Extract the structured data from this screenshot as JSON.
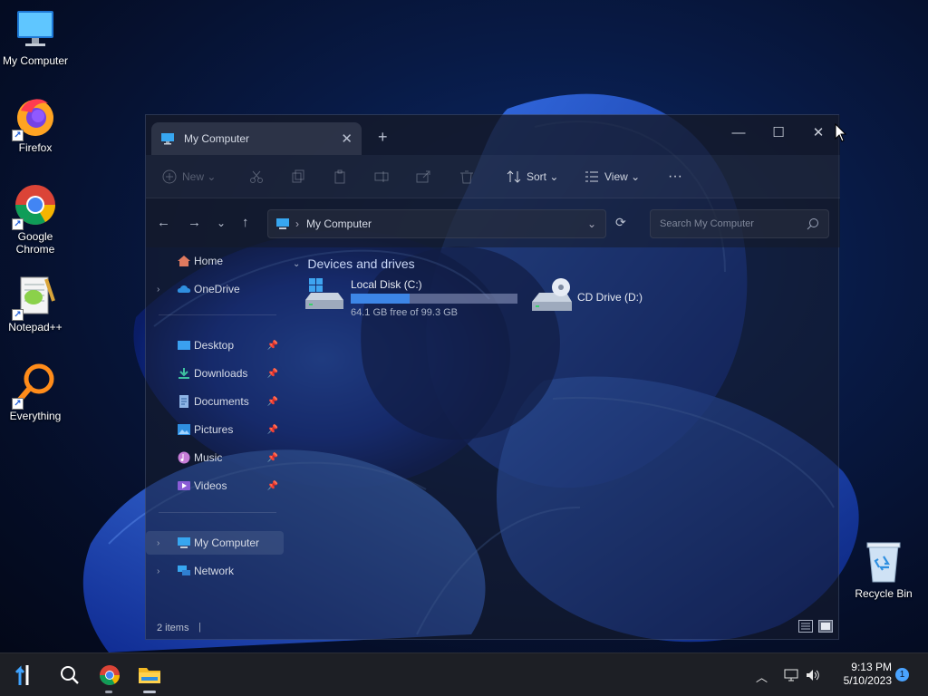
{
  "desktop": {
    "icons": [
      {
        "label": "My Computer"
      },
      {
        "label": "Firefox"
      },
      {
        "label": "Google Chrome"
      },
      {
        "label": "Notepad++"
      },
      {
        "label": "Everything"
      },
      {
        "label": "Recycle Bin"
      }
    ]
  },
  "explorer": {
    "tab_title": "My Computer",
    "toolbar": {
      "new_label": "New",
      "sort_label": "Sort",
      "view_label": "View",
      "more_label": "···"
    },
    "address": {
      "location": "My Computer",
      "search_placeholder": "Search My Computer"
    },
    "sidebar": {
      "home": "Home",
      "onedrive": "OneDrive",
      "quick_access": [
        "Desktop",
        "Downloads",
        "Documents",
        "Pictures",
        "Music",
        "Videos"
      ],
      "my_computer": "My Computer",
      "network": "Network"
    },
    "content": {
      "section_title": "Devices and drives",
      "drives": [
        {
          "name": "Local Disk (C:)",
          "free_text": "64.1 GB free of 99.3 GB",
          "used_fraction": 0.355
        },
        {
          "name": "CD Drive (D:)"
        }
      ]
    },
    "status": {
      "item_count": "2 items"
    }
  },
  "taskbar": {
    "clock_time": "9:13 PM",
    "clock_date": "5/10/2023",
    "notification_count": "1"
  }
}
